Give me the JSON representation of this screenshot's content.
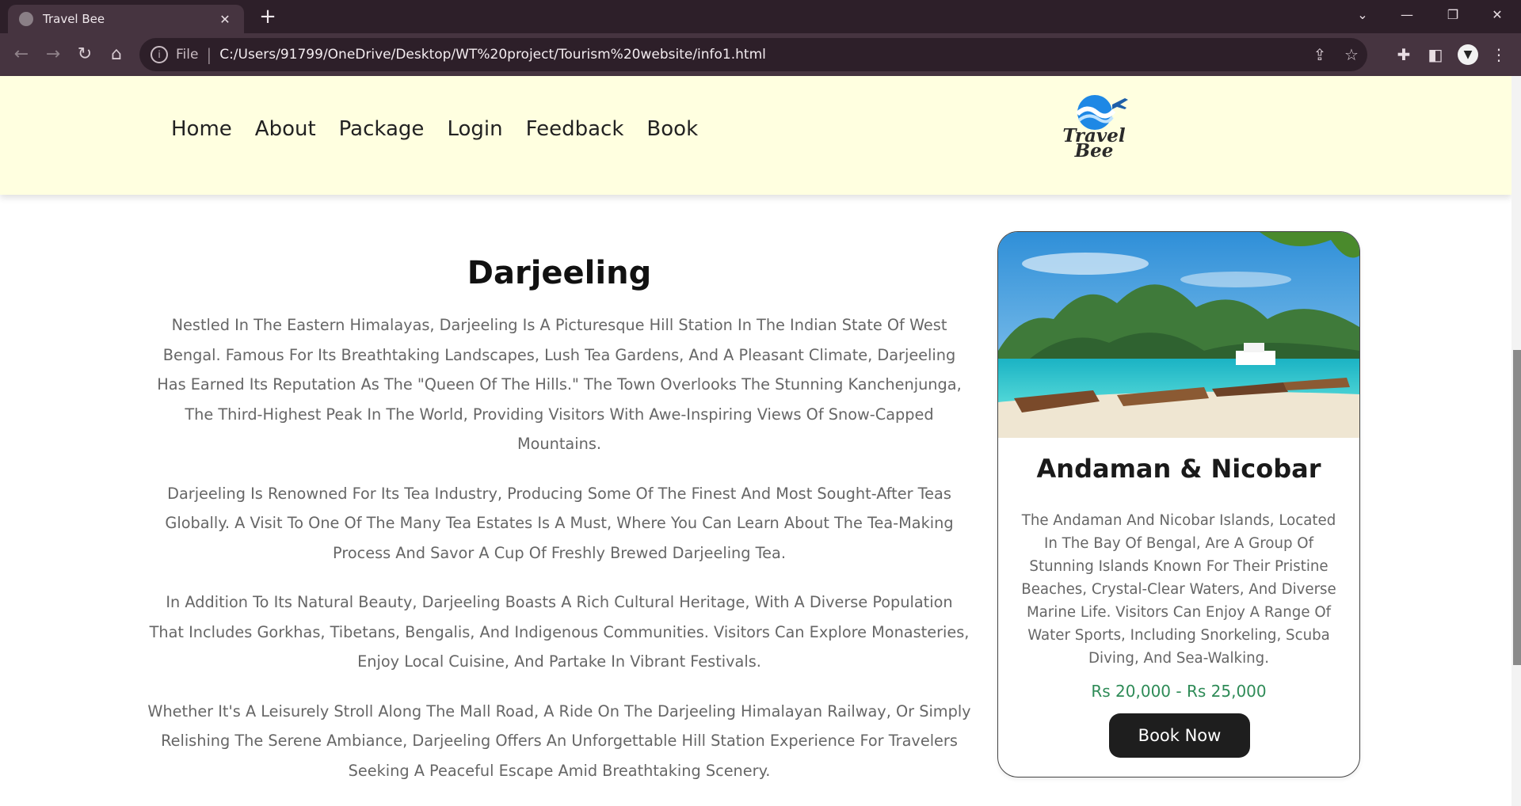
{
  "browser": {
    "tab_title": "Travel Bee",
    "tab_close": "✕",
    "new_tab": "+",
    "window_controls": {
      "tab_search": "⌄",
      "minimize": "—",
      "restore": "❐",
      "close": "✕"
    },
    "nav": {
      "back": "←",
      "forward": "→",
      "reload": "↻",
      "home": "⌂"
    },
    "address": {
      "scheme_label": "File",
      "separator": "|",
      "url": "C:/Users/91799/OneDrive/Desktop/WT%20project/Tourism%20website/info1.html"
    },
    "icons": [
      "info-icon",
      "share-icon",
      "star-icon",
      "puzzle-icon",
      "side-panel-icon",
      "extension-icon",
      "kebab-menu-icon"
    ]
  },
  "site": {
    "nav": [
      "Home",
      "About",
      "Package",
      "Login",
      "Feedback",
      "Book"
    ],
    "logo": {
      "line1": "Travel",
      "line2": "Bee",
      "colors": {
        "wave": "#1e88e5",
        "text": "#2a2a2a"
      }
    },
    "header_bg": "#ffffe0"
  },
  "article": {
    "title": "Darjeeling",
    "paragraphs": [
      "Nestled In The Eastern Himalayas, Darjeeling Is A Picturesque Hill Station In The Indian State Of West Bengal. Famous For Its Breathtaking Landscapes, Lush Tea Gardens, And A Pleasant Climate, Darjeeling Has Earned Its Reputation As The \"Queen Of The Hills.\" The Town Overlooks The Stunning Kanchenjunga, The Third-Highest Peak In The World, Providing Visitors With Awe-Inspiring Views Of Snow-Capped Mountains.",
      "Darjeeling Is Renowned For Its Tea Industry, Producing Some Of The Finest And Most Sought-After Teas Globally. A Visit To One Of The Many Tea Estates Is A Must, Where You Can Learn About The Tea-Making Process And Savor A Cup Of Freshly Brewed Darjeeling Tea.",
      "In Addition To Its Natural Beauty, Darjeeling Boasts A Rich Cultural Heritage, With A Diverse Population That Includes Gorkhas, Tibetans, Bengalis, And Indigenous Communities. Visitors Can Explore Monasteries, Enjoy Local Cuisine, And Partake In Vibrant Festivals.",
      "Whether It's A Leisurely Stroll Along The Mall Road, A Ride On The Darjeeling Himalayan Railway, Or Simply Relishing The Serene Ambiance, Darjeeling Offers An Unforgettable Hill Station Experience For Travelers Seeking A Peaceful Escape Amid Breathtaking Scenery."
    ]
  },
  "card": {
    "title": "Andaman & Nicobar",
    "description": "The Andaman And Nicobar Islands, Located In The Bay Of Bengal, Are A Group Of Stunning Islands Known For Their Pristine Beaches, Crystal-Clear Waters, And Diverse Marine Life. Visitors Can Enjoy A Range Of Water Sports, Including Snorkeling, Scuba Diving, And Sea-Walking.",
    "price": "Rs 20,000 - Rs 25,000",
    "button": "Book Now",
    "colors": {
      "price": "#2e8b57",
      "button_bg": "#1e1e1e"
    }
  }
}
